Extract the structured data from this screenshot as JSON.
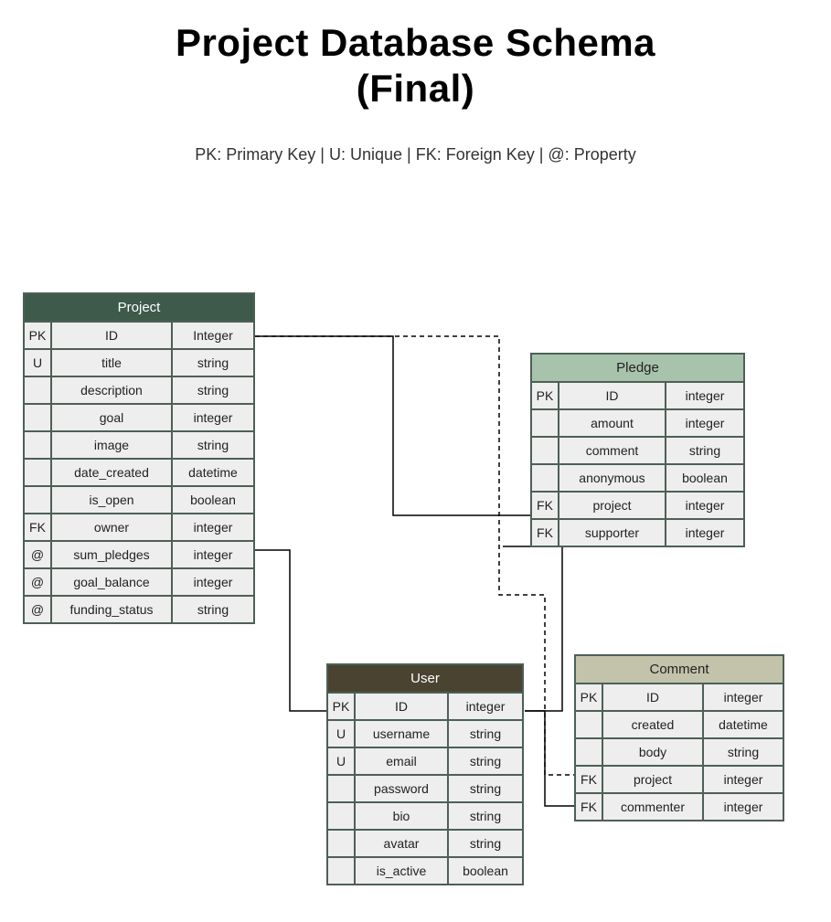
{
  "title_line1": "Project Database Schema",
  "title_line2": "(Final)",
  "legend": "PK: Primary Key | U: Unique | FK: Foreign Key | @: Property",
  "tables": {
    "project": {
      "name": "Project",
      "rows": [
        {
          "key": "PK",
          "name": "ID",
          "type": "Integer"
        },
        {
          "key": "U",
          "name": "title",
          "type": "string"
        },
        {
          "key": "",
          "name": "description",
          "type": "string"
        },
        {
          "key": "",
          "name": "goal",
          "type": "integer"
        },
        {
          "key": "",
          "name": "image",
          "type": "string"
        },
        {
          "key": "",
          "name": "date_created",
          "type": "datetime"
        },
        {
          "key": "",
          "name": "is_open",
          "type": "boolean"
        },
        {
          "key": "FK",
          "name": "owner",
          "type": "integer"
        },
        {
          "key": "@",
          "name": "sum_pledges",
          "type": "integer"
        },
        {
          "key": "@",
          "name": "goal_balance",
          "type": "integer"
        },
        {
          "key": "@",
          "name": "funding_status",
          "type": "string"
        }
      ]
    },
    "pledge": {
      "name": "Pledge",
      "rows": [
        {
          "key": "PK",
          "name": "ID",
          "type": "integer"
        },
        {
          "key": "",
          "name": "amount",
          "type": "integer"
        },
        {
          "key": "",
          "name": "comment",
          "type": "string"
        },
        {
          "key": "",
          "name": "anonymous",
          "type": "boolean"
        },
        {
          "key": "FK",
          "name": "project",
          "type": "integer"
        },
        {
          "key": "FK",
          "name": "supporter",
          "type": "integer"
        }
      ]
    },
    "user": {
      "name": "User",
      "rows": [
        {
          "key": "PK",
          "name": "ID",
          "type": "integer"
        },
        {
          "key": "U",
          "name": "username",
          "type": "string"
        },
        {
          "key": "U",
          "name": "email",
          "type": "string"
        },
        {
          "key": "",
          "name": "password",
          "type": "string"
        },
        {
          "key": "",
          "name": "bio",
          "type": "string"
        },
        {
          "key": "",
          "name": "avatar",
          "type": "string"
        },
        {
          "key": "",
          "name": "is_active",
          "type": "boolean"
        }
      ]
    },
    "comment": {
      "name": "Comment",
      "rows": [
        {
          "key": "PK",
          "name": "ID",
          "type": "integer"
        },
        {
          "key": "",
          "name": "created",
          "type": "datetime"
        },
        {
          "key": "",
          "name": "body",
          "type": "string"
        },
        {
          "key": "FK",
          "name": "project",
          "type": "integer"
        },
        {
          "key": "FK",
          "name": "commenter",
          "type": "integer"
        }
      ]
    }
  }
}
